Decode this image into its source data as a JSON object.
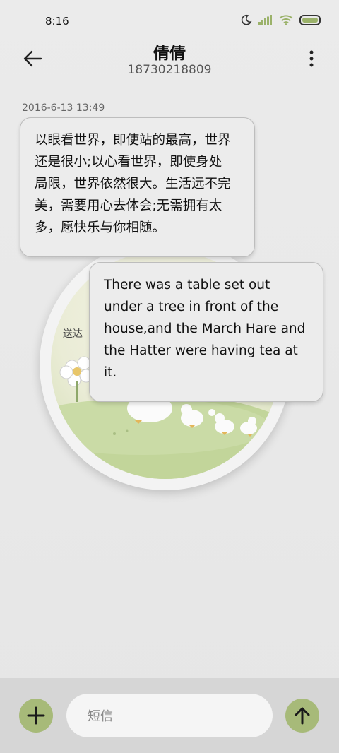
{
  "status_bar": {
    "time": "8:16",
    "icons": [
      "moon-icon",
      "signal-icon",
      "wifi-icon",
      "battery-icon"
    ]
  },
  "header": {
    "contact_name": "倩倩",
    "phone_number": "18730218809"
  },
  "conversation": {
    "timestamp": "2016-6-13 13:49",
    "messages": [
      {
        "text": "以眼看世界，即使站的最高，世界\n还是很小;以心看世界，即使身处\n局限，世界依然很大。生活远不完\n美，需要用心去体会;无需拥有太\n多，愿快乐与你相随。"
      },
      {
        "text": "There was a table set out\nunder a tree in front of the\nhouse,and the March Hare and\nthe Hatter were having tea at\nit."
      }
    ],
    "delivery_status": "送达"
  },
  "input": {
    "placeholder": "短信"
  },
  "colors": {
    "accent": "#a7ba79",
    "background": "#e9e9e9",
    "bubble": "#ececec"
  }
}
